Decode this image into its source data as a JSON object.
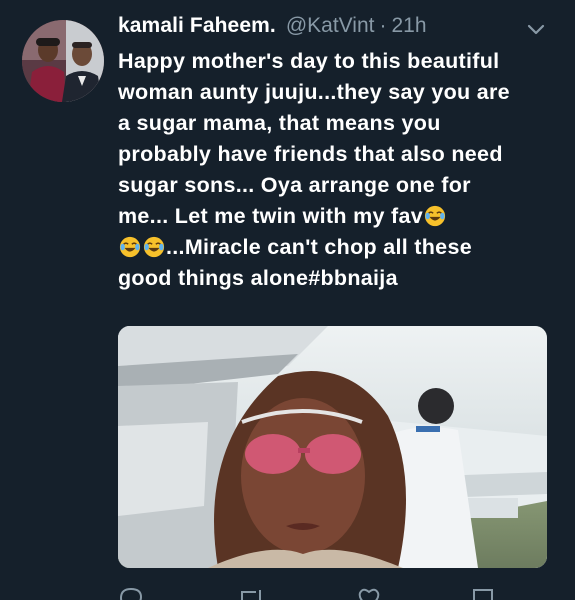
{
  "tweet": {
    "display_name": "kamali Faheem.",
    "handle": "@KatVint",
    "separator": "·",
    "timestamp": "21h",
    "text_lines": [
      "Happy mother's day to this beautiful",
      "woman aunty juuju...they say you are",
      "a sugar mama,  that means you",
      "probably have friends that also need",
      "sugar sons... Oya arrange one for",
      "me... Let me twin with my fav",
      "...Miracle can't chop all these",
      "good things alone#bbnaija"
    ],
    "emoji": "face-with-tears-of-joy",
    "media_description": "photo"
  },
  "actions": {
    "reply_count": "",
    "retweet_count": "",
    "like_count": ""
  },
  "colors": {
    "background": "#15202b",
    "text": "#ffffff",
    "secondary": "#8899a6",
    "emoji_face": "#f7c12b"
  }
}
